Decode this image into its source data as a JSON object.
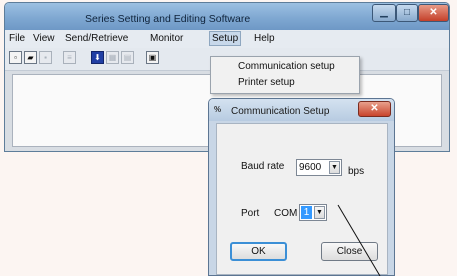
{
  "window": {
    "title": "Series Setting and Editing Software"
  },
  "menu": {
    "file": "File",
    "view": "View",
    "send_retrieve": "Send/Retrieve",
    "monitor": "Monitor",
    "setup": "Setup",
    "help": "Help"
  },
  "setup_menu": {
    "communication_setup": "Communication setup",
    "printer_setup": "Printer setup"
  },
  "dialog": {
    "icon": "%",
    "title": "Communication Setup",
    "baud_rate_label": "Baud rate",
    "baud_rate_value": "9600",
    "baud_rate_unit": "bps",
    "port_label": "Port",
    "port_prefix": "COM",
    "port_value": "1",
    "ok_label": "OK",
    "close_label": "Close"
  },
  "colors": {
    "titlebar": "#7fa8d2",
    "close_button": "#c8442c",
    "port_highlight": "#3399ff"
  },
  "icons": [
    "new-file-icon",
    "open-folder-icon",
    "save-icon",
    "print-icon",
    "download-icon",
    "grid-icon",
    "table-icon",
    "printer-icon"
  ]
}
